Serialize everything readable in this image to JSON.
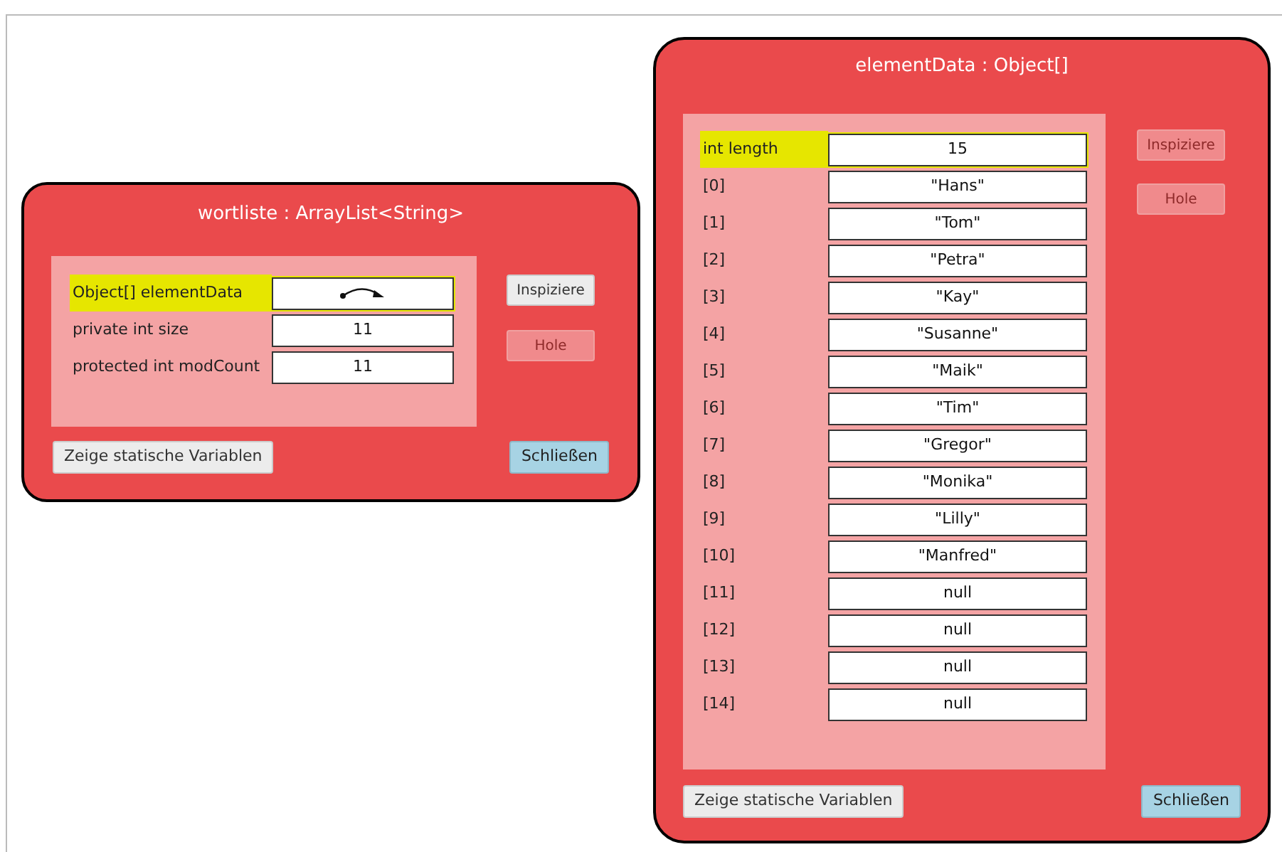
{
  "inspectors": [
    {
      "title": "wortliste : ArrayList<String>",
      "fields": [
        {
          "label": "Object[] elementData",
          "kind": "reference",
          "selected": true
        },
        {
          "label": "private int size",
          "kind": "value",
          "value": "11",
          "selected": false
        },
        {
          "label": "protected int modCount",
          "kind": "value",
          "value": "11",
          "selected": false
        }
      ],
      "actions": [
        {
          "label": "Inspiziere",
          "disabled": false
        },
        {
          "label": "Hole",
          "disabled": true
        }
      ],
      "static_button": "Zeige statische Variablen",
      "close_button": "Schließen"
    },
    {
      "title": "elementData : Object[]",
      "fields": [
        {
          "label": "int length",
          "kind": "value",
          "value": "15",
          "selected": true
        },
        {
          "label": "[0]",
          "kind": "value",
          "value": "\"Hans\"",
          "selected": false
        },
        {
          "label": "[1]",
          "kind": "value",
          "value": "\"Tom\"",
          "selected": false
        },
        {
          "label": "[2]",
          "kind": "value",
          "value": "\"Petra\"",
          "selected": false
        },
        {
          "label": "[3]",
          "kind": "value",
          "value": "\"Kay\"",
          "selected": false
        },
        {
          "label": "[4]",
          "kind": "value",
          "value": "\"Susanne\"",
          "selected": false
        },
        {
          "label": "[5]",
          "kind": "value",
          "value": "\"Maik\"",
          "selected": false
        },
        {
          "label": "[6]",
          "kind": "value",
          "value": "\"Tim\"",
          "selected": false
        },
        {
          "label": "[7]",
          "kind": "value",
          "value": "\"Gregor\"",
          "selected": false
        },
        {
          "label": "[8]",
          "kind": "value",
          "value": "\"Monika\"",
          "selected": false
        },
        {
          "label": "[9]",
          "kind": "value",
          "value": "\"Lilly\"",
          "selected": false
        },
        {
          "label": "[10]",
          "kind": "value",
          "value": "\"Manfred\"",
          "selected": false
        },
        {
          "label": "[11]",
          "kind": "value",
          "value": "null",
          "selected": false
        },
        {
          "label": "[12]",
          "kind": "value",
          "value": "null",
          "selected": false
        },
        {
          "label": "[13]",
          "kind": "value",
          "value": "null",
          "selected": false
        },
        {
          "label": "[14]",
          "kind": "value",
          "value": "null",
          "selected": false
        }
      ],
      "actions": [
        {
          "label": "Inspiziere",
          "disabled": true
        },
        {
          "label": "Hole",
          "disabled": true
        }
      ],
      "static_button": "Zeige statische Variablen",
      "close_button": "Schließen"
    }
  ]
}
